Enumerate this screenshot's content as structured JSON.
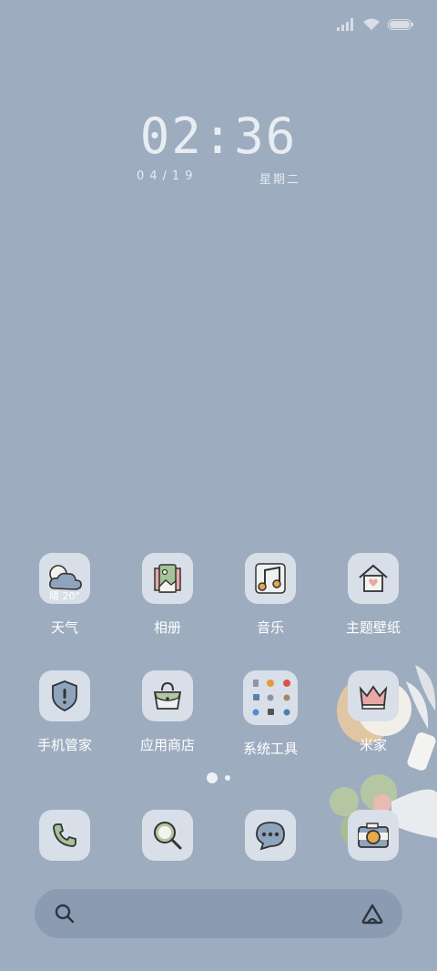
{
  "status": {
    "signal_icon": "signal-icon",
    "wifi_icon": "wifi-icon",
    "battery_icon": "battery-icon"
  },
  "clock": {
    "time": "02:36",
    "date": "04/19",
    "weekday": "星期二"
  },
  "apps": [
    {
      "id": "weather",
      "label": "天气",
      "icon": "weather-icon",
      "badge": "晴 20°"
    },
    {
      "id": "gallery",
      "label": "相册",
      "icon": "gallery-icon"
    },
    {
      "id": "music",
      "label": "音乐",
      "icon": "music-icon"
    },
    {
      "id": "themes",
      "label": "主题壁纸",
      "icon": "theme-house-icon"
    },
    {
      "id": "security",
      "label": "手机管家",
      "icon": "shield-icon"
    },
    {
      "id": "appstore",
      "label": "应用商店",
      "icon": "shopping-bag-icon"
    },
    {
      "id": "tools",
      "label": "系统工具",
      "icon": "folder-icon"
    },
    {
      "id": "mihome",
      "label": "米家",
      "icon": "crown-icon"
    }
  ],
  "dock": [
    {
      "id": "phone",
      "icon": "phone-icon"
    },
    {
      "id": "browser",
      "icon": "search-magnifier-icon"
    },
    {
      "id": "messages",
      "icon": "message-bubble-icon"
    },
    {
      "id": "camera",
      "icon": "camera-icon"
    }
  ],
  "page_indicator": {
    "pages": 2,
    "current": 1
  },
  "searchbar": {
    "search_icon": "search-icon",
    "assistant_icon": "assistant-icon"
  },
  "colors": {
    "background": "#9eacc0",
    "icon_bg": "#d9dfe8",
    "searchbar": "#8b9bb1",
    "label": "#ffffff"
  }
}
